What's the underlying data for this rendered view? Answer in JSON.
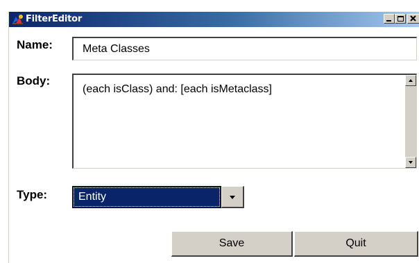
{
  "window": {
    "title": "FilterEditor",
    "controls": {
      "minimize": "minimize",
      "maximize": "maximize",
      "close": "close"
    }
  },
  "form": {
    "name_label": "Name:",
    "name_value": "Meta Classes",
    "body_label": "Body:",
    "body_value": "(each isClass) and: [each isMetaclass]",
    "type_label": "Type:",
    "type_value": "Entity"
  },
  "buttons": {
    "save_label": "Save",
    "quit_label": "Quit"
  },
  "icons": {
    "app": "filter-editor-icon",
    "dropdown": "chevron-down-icon",
    "scroll_up": "scroll-up-icon",
    "scroll_down": "scroll-down-icon"
  },
  "colors": {
    "title_start": "#0a246a",
    "title_end": "#a6caf0",
    "selection": "#0a246a",
    "chrome": "#d4d0c8"
  }
}
